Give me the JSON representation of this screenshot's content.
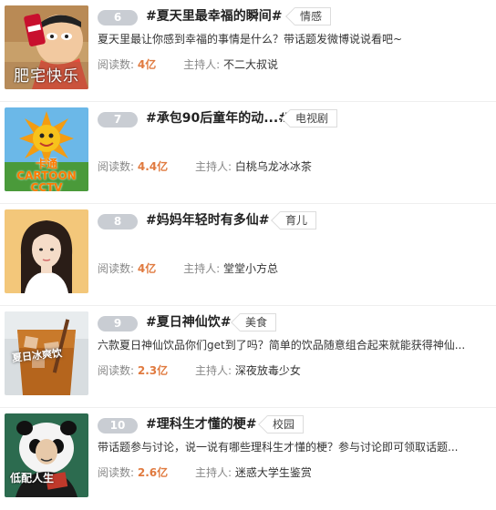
{
  "labels": {
    "reads": "阅读数:",
    "host": "主持人:"
  },
  "colors": {
    "accent": "#e07a3f",
    "rank_badge": "#c9cdd3"
  },
  "items": [
    {
      "rank": "6",
      "title": "#夏天里最幸福的瞬间#",
      "tag": "情感",
      "desc": "夏天里最让你感到幸福的事情是什么？带话题发微博说说看吧~",
      "reads": "4亿",
      "host": "不二大叔说",
      "thumb_caption": "肥宅快乐"
    },
    {
      "rank": "7",
      "title": "#承包90后童年的动...#",
      "tag": "电视剧",
      "desc": "",
      "reads": "4.4亿",
      "host": "白桃乌龙冰冰茶",
      "thumb_caption": "卡通 CARTOON CCTV"
    },
    {
      "rank": "8",
      "title": "#妈妈年轻时有多仙#",
      "tag": "育儿",
      "desc": "",
      "reads": "4亿",
      "host": "堂堂小方总",
      "thumb_caption": ""
    },
    {
      "rank": "9",
      "title": "#夏日神仙饮#",
      "tag": "美食",
      "desc": "六款夏日神仙饮品你们get到了吗？简单的饮品随意组合起来就能获得神仙...",
      "reads": "2.3亿",
      "host": "深夜放毒少女",
      "thumb_caption": "夏日冰爽饮"
    },
    {
      "rank": "10",
      "title": "#理科生才懂的梗#",
      "tag": "校园",
      "desc": "带话题参与讨论，说一说有哪些理科生才懂的梗？参与讨论即可领取话题...",
      "reads": "2.6亿",
      "host": "迷惑大学生鉴赏",
      "thumb_caption": "低配人生"
    }
  ]
}
